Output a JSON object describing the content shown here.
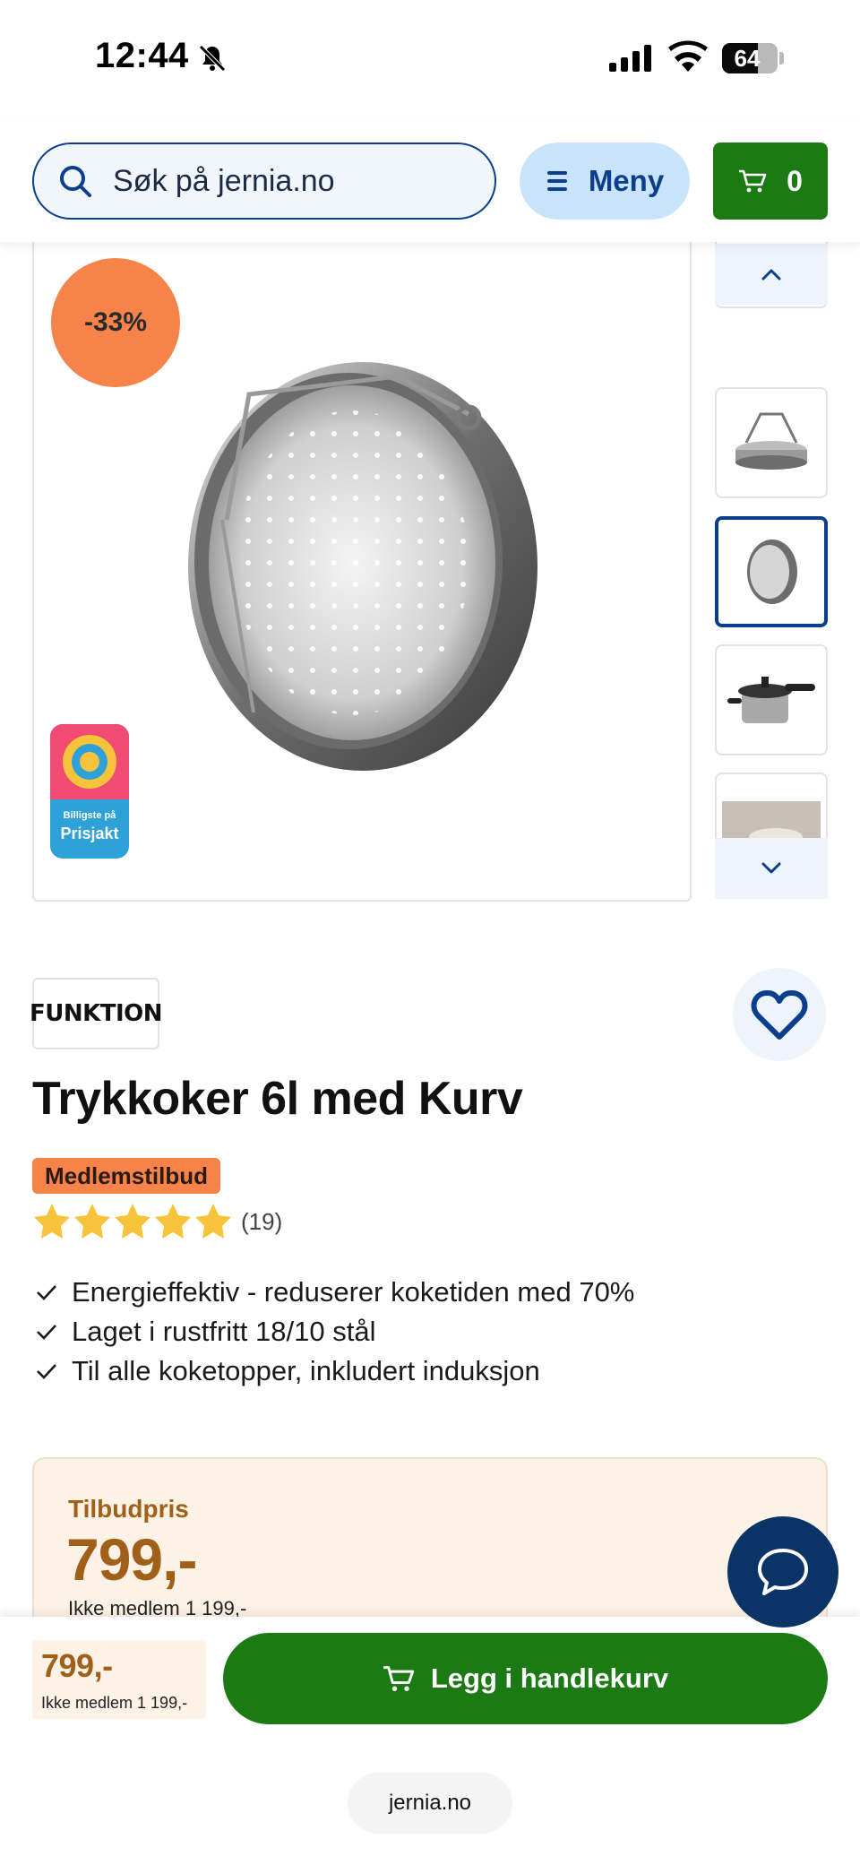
{
  "status_bar": {
    "time": "12:44",
    "battery": "64"
  },
  "header": {
    "search_placeholder": "Søk på jernia.no",
    "menu_label": "Meny",
    "cart_count": "0"
  },
  "gallery": {
    "discount_badge": "-33%",
    "prisjakt_small": "Billigste på",
    "prisjakt_big": "Prisjakt"
  },
  "product": {
    "brand": "FUNKTION",
    "title": "Trykkoker 6l med Kurv",
    "member_badge": "Medlemstilbud",
    "rating_stars": 5,
    "review_count": "(19)",
    "features": [
      "Energieffektiv - reduserer koketiden med 70%",
      "Laget i rustfritt 18/10 stål",
      "Til alle koketopper, inkludert induksjon"
    ]
  },
  "price_card": {
    "label": "Tilbudpris",
    "price": "799,-",
    "non_member": "Ikke medlem 1 199,-"
  },
  "bottom_bar": {
    "price": "799,-",
    "non_member": "Ikke medlem 1 199,-",
    "add_to_cart": "Legg i handlekurv",
    "url": "jernia.no"
  },
  "colors": {
    "primary_blue": "#0b3e8c",
    "green": "#1b7a14",
    "discount_orange": "#f6834a",
    "price_brown": "#a0601a",
    "price_bg": "#fdf2e6",
    "star": "#f6c33b"
  }
}
